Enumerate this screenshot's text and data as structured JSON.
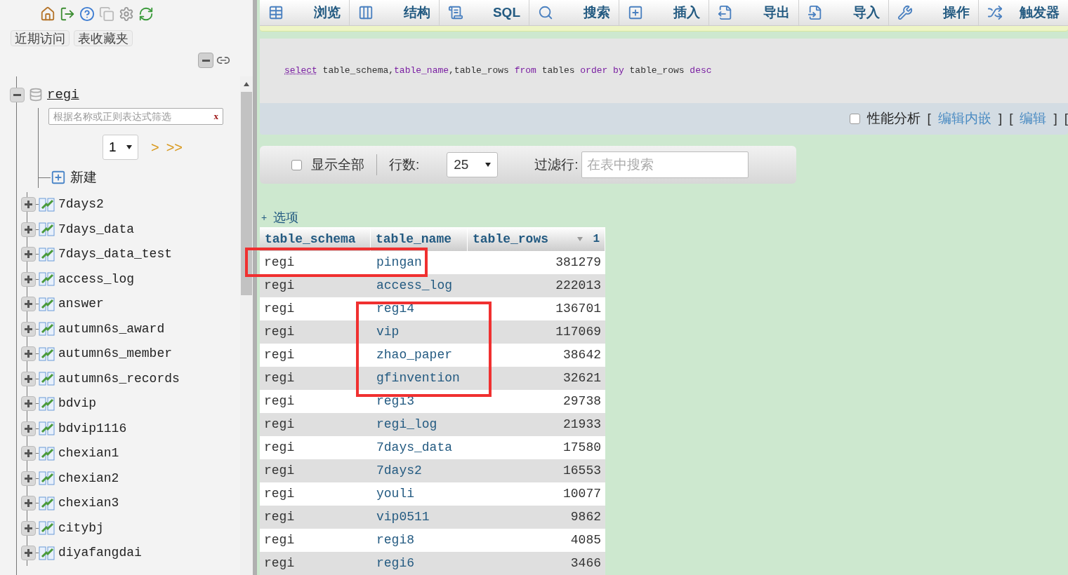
{
  "sidebar": {
    "tabs": [
      "近期访问",
      "表收藏夹"
    ],
    "database": {
      "name": "regi",
      "expanded": true,
      "filter_placeholder": "根据名称或正则表达式筛选",
      "filter_clear": "x",
      "page": "1",
      "next": ">",
      "last": ">>",
      "new_label": "新建",
      "tables": [
        {
          "name": "7days2",
          "expanded": false
        },
        {
          "name": "7days_data",
          "expanded": false
        },
        {
          "name": "7days_data_test",
          "expanded": false
        },
        {
          "name": "access_log",
          "expanded": false
        },
        {
          "name": "answer",
          "expanded": false
        },
        {
          "name": "autumn6s_award",
          "expanded": false
        },
        {
          "name": "autumn6s_member",
          "expanded": false
        },
        {
          "name": "autumn6s_records",
          "expanded": false
        },
        {
          "name": "bdvip",
          "expanded": false
        },
        {
          "name": "bdvip1116",
          "expanded": false
        },
        {
          "name": "chexian1",
          "expanded": false
        },
        {
          "name": "chexian2",
          "expanded": false
        },
        {
          "name": "chexian3",
          "expanded": false
        },
        {
          "name": "citybj",
          "expanded": false
        },
        {
          "name": "diyafangdai",
          "expanded": false
        }
      ]
    }
  },
  "toolbar": {
    "tabs": [
      {
        "label": "浏览"
      },
      {
        "label": "结构"
      },
      {
        "label": "SQL"
      },
      {
        "label": "搜索"
      },
      {
        "label": "插入"
      },
      {
        "label": "导出"
      },
      {
        "label": "导入"
      },
      {
        "label": "操作"
      },
      {
        "label": "触发器"
      }
    ]
  },
  "query": {
    "segments": [
      {
        "text": "select",
        "kind": "link"
      },
      {
        "text": " table_schema,",
        "kind": "plain"
      },
      {
        "text": "table_name",
        "kind": "keyword"
      },
      {
        "text": ",table_rows ",
        "kind": "plain"
      },
      {
        "text": "from",
        "kind": "keyword"
      },
      {
        "text": " tables ",
        "kind": "plain"
      },
      {
        "text": "order by",
        "kind": "keyword"
      },
      {
        "text": " table_rows ",
        "kind": "plain"
      },
      {
        "text": "desc",
        "kind": "keyword"
      }
    ],
    "profiling": {
      "label": "性能分析",
      "checked": false
    },
    "actions": [
      {
        "text": "[",
        "kind": "bracket"
      },
      {
        "text": "编辑内嵌",
        "kind": "link"
      },
      {
        "text": "]",
        "kind": "bracket"
      },
      {
        "text": "[",
        "kind": "bracket"
      },
      {
        "text": "编辑",
        "kind": "link"
      },
      {
        "text": "]",
        "kind": "bracket"
      },
      {
        "text": "[",
        "kind": "bracket"
      }
    ]
  },
  "navigation": {
    "show_all": {
      "label": "显示全部",
      "checked": false
    },
    "rows_label": "行数:",
    "rows_value": "25",
    "filter_label": "过滤行:",
    "filter_placeholder": "在表中搜索"
  },
  "options_toggle": {
    "sign": "+",
    "label": "选项"
  },
  "table": {
    "columns": [
      {
        "label": "table_schema"
      },
      {
        "label": "table_name"
      },
      {
        "label": "table_rows",
        "sort_order": "1"
      }
    ],
    "rows": [
      [
        "regi",
        "pingan",
        "381279"
      ],
      [
        "regi",
        "access_log",
        "222013"
      ],
      [
        "regi",
        "regi4",
        "136701"
      ],
      [
        "regi",
        "vip",
        "117069"
      ],
      [
        "regi",
        "zhao_paper",
        "38642"
      ],
      [
        "regi",
        "gfinvention",
        "32621"
      ],
      [
        "regi",
        "regi3",
        "29738"
      ],
      [
        "regi",
        "regi_log",
        "21933"
      ],
      [
        "regi",
        "7days_data",
        "17580"
      ],
      [
        "regi",
        "7days2",
        "16553"
      ],
      [
        "regi",
        "youli",
        "10077"
      ],
      [
        "regi",
        "vip0511",
        "9862"
      ],
      [
        "regi",
        "regi8",
        "4085"
      ],
      [
        "regi",
        "regi6",
        "3466"
      ]
    ]
  }
}
